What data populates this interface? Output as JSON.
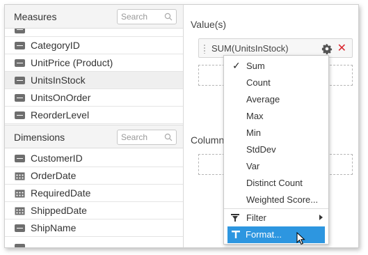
{
  "measures": {
    "title": "Measures",
    "search_placeholder": "Search",
    "items": [
      {
        "label": "CategoryID",
        "type": "number"
      },
      {
        "label": "UnitPrice (Product)",
        "type": "number"
      },
      {
        "label": "UnitsInStock",
        "type": "number",
        "selected": true
      },
      {
        "label": "UnitsOnOrder",
        "type": "number"
      },
      {
        "label": "ReorderLevel",
        "type": "number"
      }
    ]
  },
  "dimensions": {
    "title": "Dimensions",
    "search_placeholder": "Search",
    "items": [
      {
        "label": "CustomerID",
        "type": "string"
      },
      {
        "label": "OrderDate",
        "type": "date"
      },
      {
        "label": "RequiredDate",
        "type": "date"
      },
      {
        "label": "ShippedDate",
        "type": "date"
      },
      {
        "label": "ShipName",
        "type": "string"
      }
    ]
  },
  "values_panel": {
    "label": "Value(s)",
    "pill_text": "SUM(UnitsInStock)"
  },
  "columns_panel": {
    "label": "Column("
  },
  "context_menu": {
    "items": [
      {
        "label": "Sum",
        "checked": true
      },
      {
        "label": "Count"
      },
      {
        "label": "Average"
      },
      {
        "label": "Max"
      },
      {
        "label": "Min"
      },
      {
        "label": "StdDev"
      },
      {
        "label": "Var"
      },
      {
        "label": "Distinct Count"
      },
      {
        "label": "Weighted Score..."
      },
      {
        "label": "Filter",
        "submenu": true,
        "icon": "filter-icon"
      },
      {
        "label": "Format...",
        "active": true,
        "icon": "format-icon"
      }
    ]
  },
  "colors": {
    "accent": "#2d96e0",
    "remove": "#d9262f"
  }
}
